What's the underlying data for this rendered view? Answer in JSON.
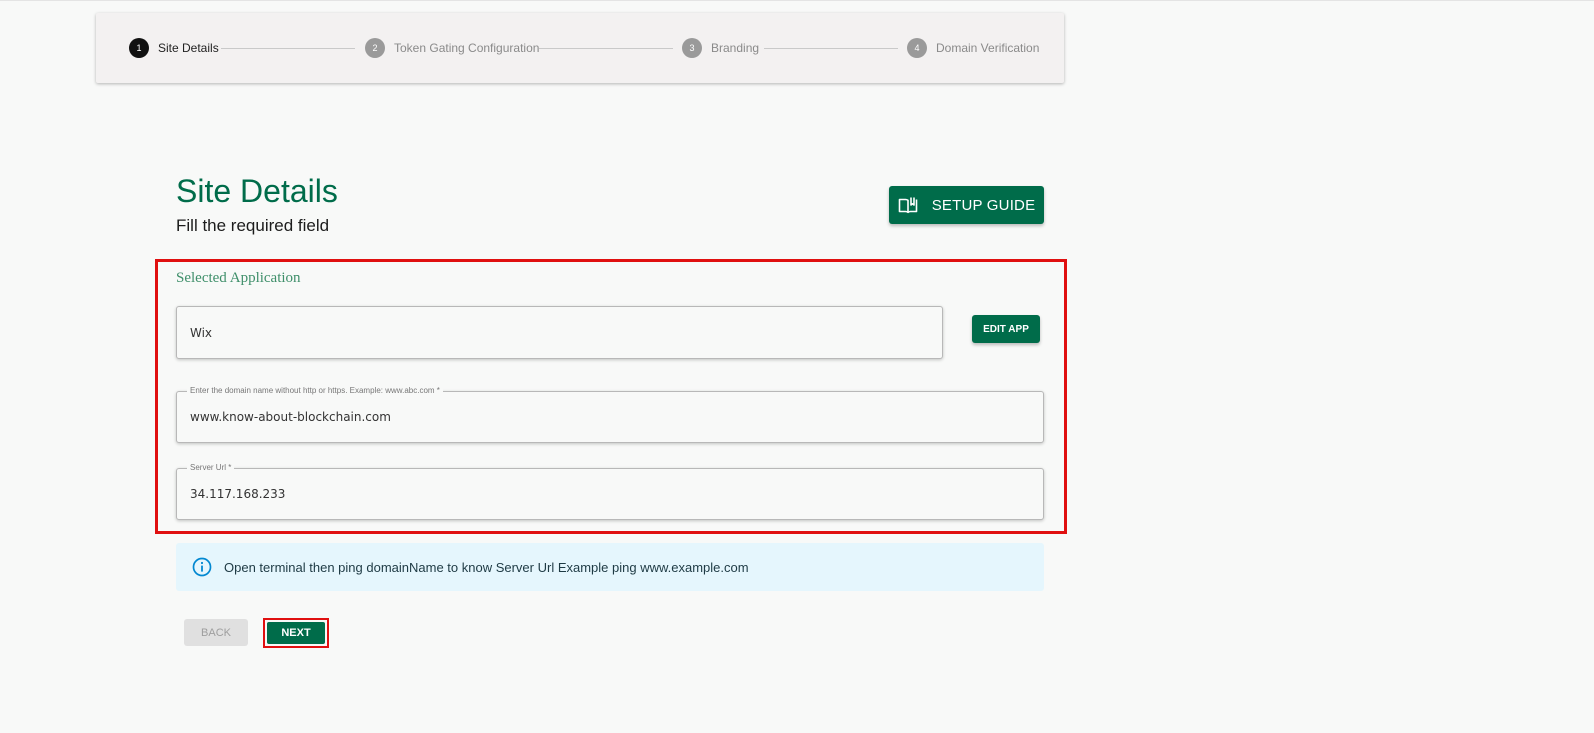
{
  "stepper": {
    "steps": [
      {
        "number": "1",
        "label": "Site Details",
        "active": true
      },
      {
        "number": "2",
        "label": "Token Gating Configuration",
        "active": false
      },
      {
        "number": "3",
        "label": "Branding",
        "active": false
      },
      {
        "number": "4",
        "label": "Domain Verification",
        "active": false
      }
    ]
  },
  "header": {
    "title": "Site Details",
    "subtitle": "Fill the required field",
    "setup_guide_label": "SETUP GUIDE",
    "setup_guide_icon": "book-open-icon"
  },
  "form": {
    "section_label": "Selected Application",
    "application": {
      "value": "Wix"
    },
    "edit_app_label": "EDIT APP",
    "domain": {
      "legend": "Enter the domain name without http or https. Example: www.abc.com *",
      "value": "www.know-about-blockchain.com"
    },
    "server_url": {
      "legend": "Server Url *",
      "value": "34.117.168.233"
    }
  },
  "info": {
    "icon": "info-icon",
    "message": "Open terminal then ping domainName to know Server Url Example ping www.example.com"
  },
  "actions": {
    "back_label": "BACK",
    "next_label": "NEXT"
  },
  "colors": {
    "primary": "#006c4a",
    "highlight": "#e01010",
    "info_bg": "#e5f6fd",
    "info_icon": "#0288d1"
  }
}
